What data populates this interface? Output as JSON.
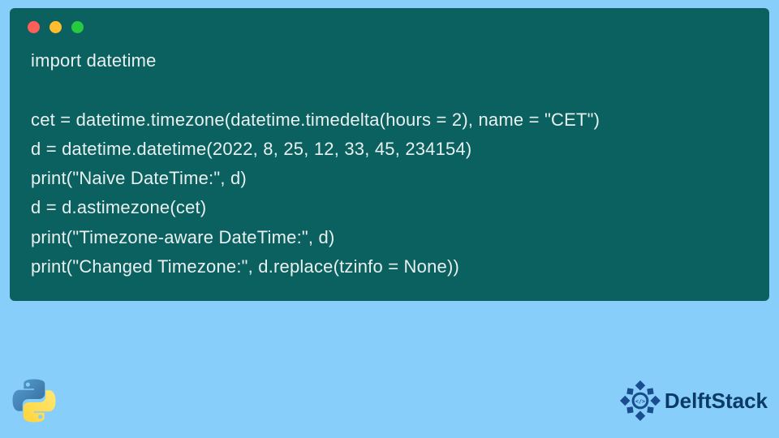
{
  "code": {
    "lines": [
      "import datetime",
      "",
      "cet = datetime.timezone(datetime.timedelta(hours = 2), name = \"CET\")",
      "d = datetime.datetime(2022, 8, 25, 12, 33, 45, 234154)",
      "print(\"Naive DateTime:\", d)",
      "d = d.astimezone(cet)",
      "print(\"Timezone-aware DateTime:\", d)",
      "print(\"Changed Timezone:\", d.replace(tzinfo = None))"
    ]
  },
  "brand": {
    "name": "DelftStack"
  }
}
